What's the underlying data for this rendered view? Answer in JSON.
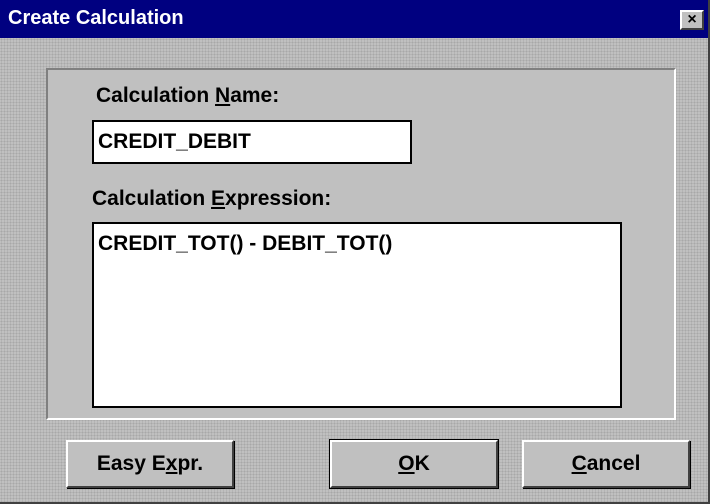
{
  "window": {
    "title": "Create Calculation",
    "close_glyph": "×"
  },
  "form": {
    "name_label_pre": "Calculation ",
    "name_label_key": "N",
    "name_label_post": "ame:",
    "name_value": "CREDIT_DEBIT",
    "expr_label_pre": "Calculation ",
    "expr_label_key": "E",
    "expr_label_post": "xpression:",
    "expr_value": "CREDIT_TOT() - DEBIT_TOT()"
  },
  "buttons": {
    "easy_pre": "Easy E",
    "easy_key": "x",
    "easy_post": "pr.",
    "ok_key": "O",
    "ok_post": "K",
    "cancel_key": "C",
    "cancel_post": "ancel"
  }
}
